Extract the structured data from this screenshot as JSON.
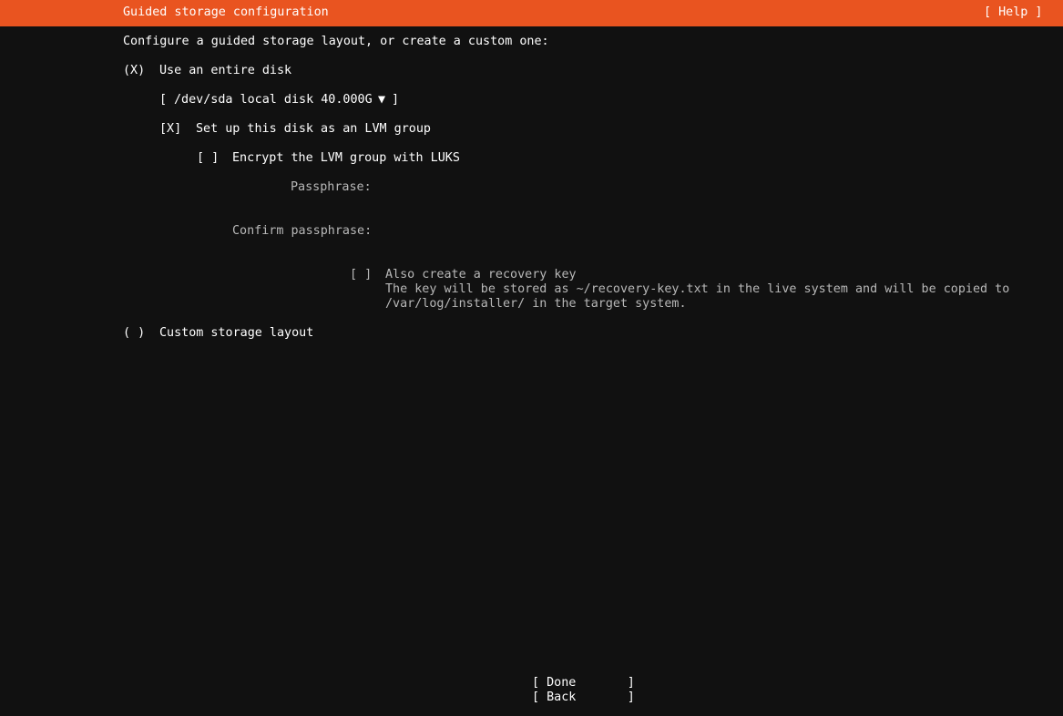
{
  "header": {
    "title": "Guided storage configuration",
    "help_button": "[ Help ]",
    "bg_color": "#e95420"
  },
  "intro": "Configure a guided storage layout, or create a custom one:",
  "entire_disk": {
    "radio": "(X)",
    "label": "Use an entire disk",
    "disk_select": {
      "open_bracket": "[",
      "value": "/dev/sda local disk 40.000G",
      "arrow": "▼",
      "close_bracket": "]"
    },
    "lvm": {
      "checkbox": "[X]",
      "label": "Set up this disk as an LVM group"
    },
    "luks": {
      "checkbox": "[ ]",
      "label": "Encrypt the LVM group with LUKS"
    },
    "passphrase_label": "Passphrase:",
    "passphrase_value": "",
    "confirm_passphrase_label": "Confirm passphrase:",
    "confirm_passphrase_value": "",
    "recovery": {
      "checkbox": "[ ]",
      "label": "Also create a recovery key",
      "description_line1": "The key will be stored as ~/recovery-key.txt in the live system and will be copied to",
      "description_line2": "/var/log/installer/ in the target system."
    }
  },
  "custom_layout": {
    "radio": "( )",
    "label": "Custom storage layout"
  },
  "buttons": {
    "done": "[ Done       ]",
    "back": "[ Back       ]"
  },
  "colors": {
    "background": "#111111",
    "text": "#ffffff",
    "disabled_text": "#b8b8b8"
  }
}
